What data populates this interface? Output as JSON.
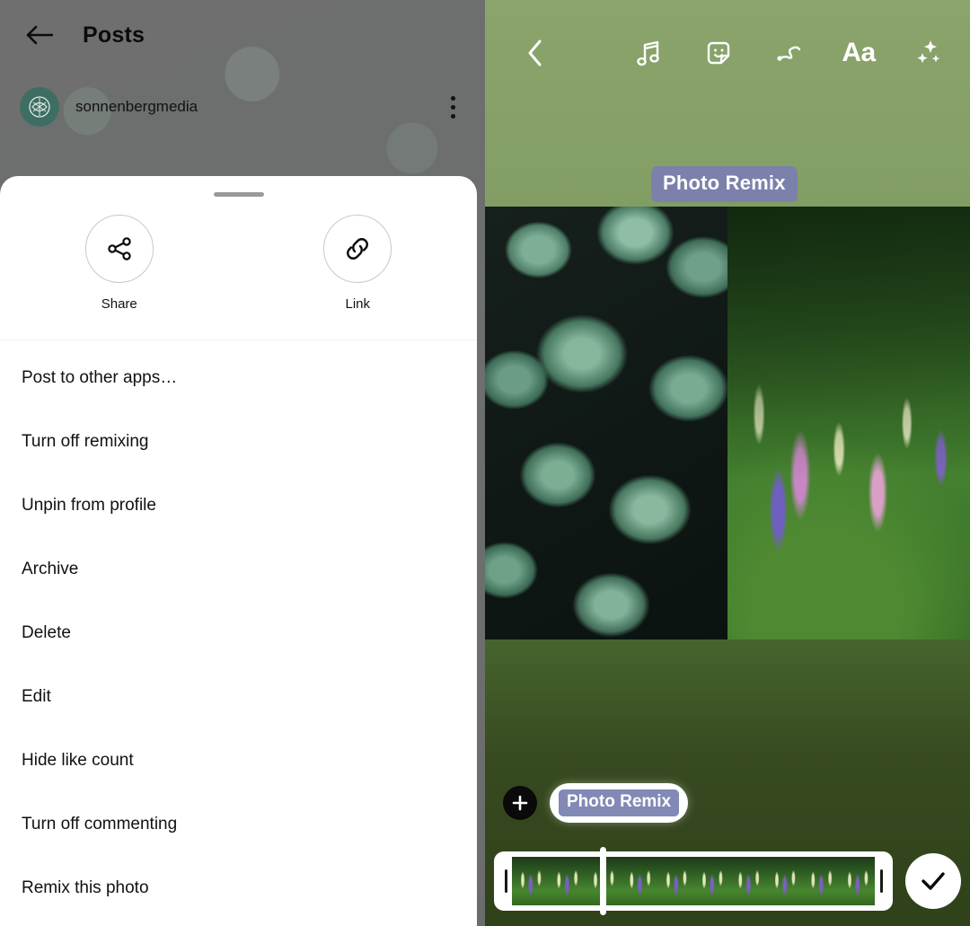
{
  "left": {
    "header": {
      "back_icon": "back-arrow-icon",
      "title": "Posts"
    },
    "post": {
      "avatar_icon": "profile-avatar-leaf-mark",
      "username": "sonnenbergmedia",
      "overflow_icon": "three-dot-menu-icon"
    },
    "sheet": {
      "grabber_icon": "drag-handle",
      "quick_actions": [
        {
          "label": "Share",
          "icon": "share-nodes-icon"
        },
        {
          "label": "Link",
          "icon": "link-chain-icon"
        }
      ],
      "menu_items": [
        "Post to other apps…",
        "Turn off remixing",
        "Unpin from profile",
        "Archive",
        "Delete",
        "Edit",
        "Hide like count",
        "Turn off commenting",
        "Remix this photo"
      ]
    }
  },
  "right": {
    "toolbar": {
      "back_icon": "chevron-left-icon",
      "items": [
        {
          "icon": "music-note-icon",
          "label": "Music"
        },
        {
          "icon": "sticker-icon",
          "label": "Sticker"
        },
        {
          "icon": "draw-squiggle-icon",
          "label": "Draw"
        },
        {
          "icon": "text-aa-icon",
          "label": "Aa"
        },
        {
          "icon": "sparkles-effects-icon",
          "label": "Effects"
        }
      ],
      "aa_label": "Aa"
    },
    "canvas": {
      "sticker_label": "Photo Remix",
      "media": [
        {
          "name": "succulent-photo",
          "alt": "Green succulent rosettes"
        },
        {
          "name": "lupine-photo",
          "alt": "Purple and pink lupine flowers"
        }
      ]
    },
    "chip_bar": {
      "add_icon": "plus-icon",
      "chip_label": "Photo Remix"
    },
    "bottom": {
      "scrubber_icon": "video-filmstrip-scrubber",
      "playhead_icon": "playhead-marker",
      "trim_left_icon": "trim-handle-left",
      "trim_right_icon": "trim-handle-right",
      "confirm_icon": "checkmark-icon"
    }
  },
  "colors": {
    "sticker_purple": "#7b81ab",
    "chip_purple": "#8289b5",
    "avatar_teal": "#3e6e63",
    "bg_top_green": "#8aa46c",
    "bg_bottom_green": "#2f4119",
    "overlay_gray": "#808080"
  }
}
